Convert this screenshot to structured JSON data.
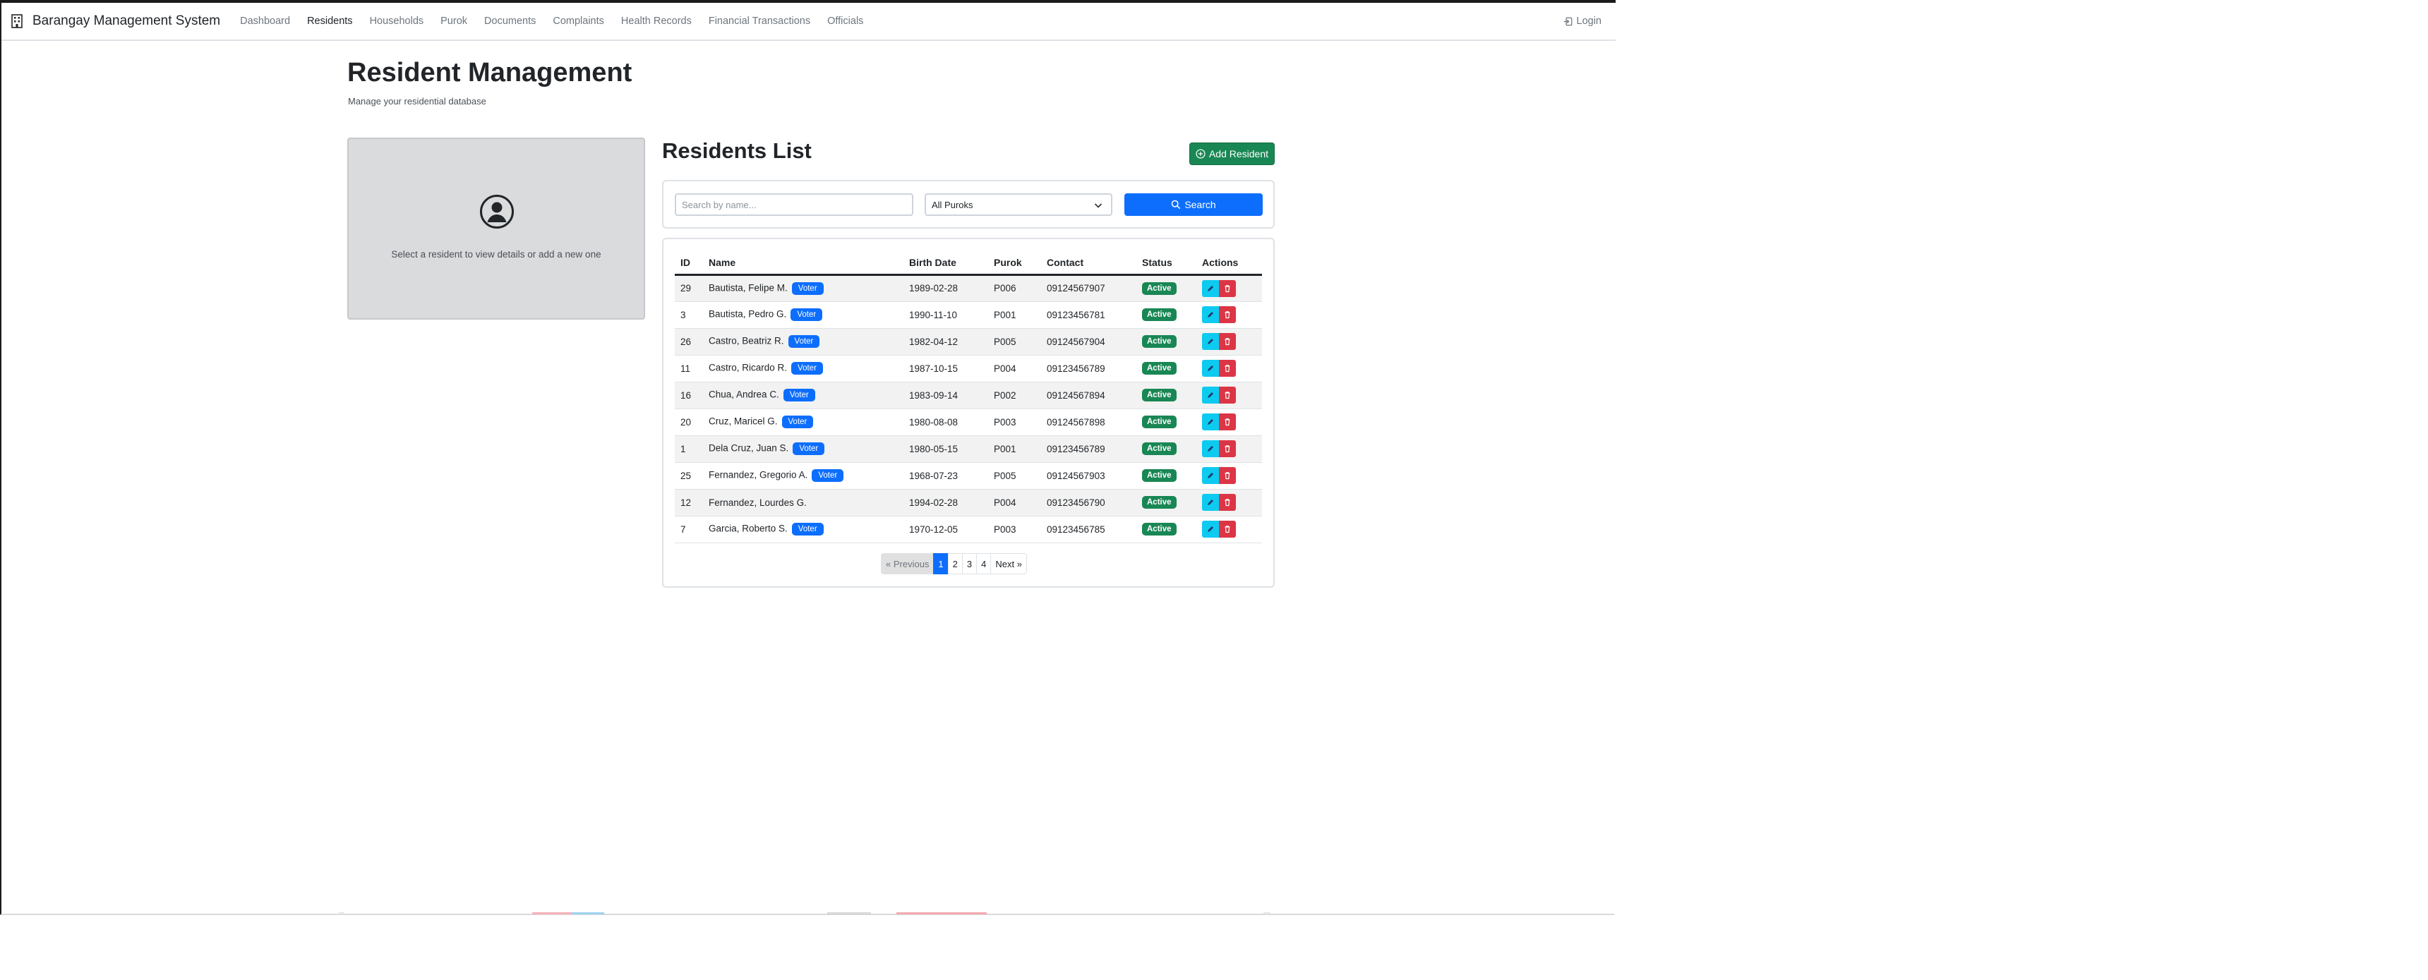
{
  "brand": {
    "title": "Barangay Management System"
  },
  "nav": {
    "items": [
      "Dashboard",
      "Residents",
      "Households",
      "Purok",
      "Documents",
      "Complaints",
      "Health Records",
      "Financial Transactions",
      "Officials"
    ],
    "active": "Residents",
    "login_label": "Login"
  },
  "header": {
    "title": "Resident Management",
    "subtitle": "Manage your residential database"
  },
  "detail_panel": {
    "placeholder_text": "Select a resident to view details or add a new one"
  },
  "residents": {
    "title": "Residents List",
    "add_button_label": "Add Resident",
    "search": {
      "placeholder": "Search by name...",
      "purok_selected": "All Puroks",
      "button_label": "Search"
    },
    "columns": [
      "ID",
      "Name",
      "Birth Date",
      "Purok",
      "Contact",
      "Status",
      "Actions"
    ],
    "rows": [
      {
        "id": "29",
        "name": "Bautista, Felipe M.",
        "voter": "Voter",
        "birth_date": "1989-02-28",
        "purok": "P006",
        "contact": "09124567907",
        "status": "Active"
      },
      {
        "id": "3",
        "name": "Bautista, Pedro G.",
        "voter": "Voter",
        "birth_date": "1990-11-10",
        "purok": "P001",
        "contact": "09123456781",
        "status": "Active"
      },
      {
        "id": "26",
        "name": "Castro, Beatriz R.",
        "voter": "Voter",
        "birth_date": "1982-04-12",
        "purok": "P005",
        "contact": "09124567904",
        "status": "Active"
      },
      {
        "id": "11",
        "name": "Castro, Ricardo R.",
        "voter": "Voter",
        "birth_date": "1987-10-15",
        "purok": "P004",
        "contact": "09123456789",
        "status": "Active"
      },
      {
        "id": "16",
        "name": "Chua, Andrea C.",
        "voter": "Voter",
        "birth_date": "1983-09-14",
        "purok": "P002",
        "contact": "09124567894",
        "status": "Active"
      },
      {
        "id": "20",
        "name": "Cruz, Maricel G.",
        "voter": "Voter",
        "birth_date": "1980-08-08",
        "purok": "P003",
        "contact": "09124567898",
        "status": "Active"
      },
      {
        "id": "1",
        "name": "Dela Cruz, Juan S.",
        "voter": "Voter",
        "birth_date": "1980-05-15",
        "purok": "P001",
        "contact": "09123456789",
        "status": "Active"
      },
      {
        "id": "25",
        "name": "Fernandez, Gregorio A.",
        "voter": "Voter",
        "birth_date": "1968-07-23",
        "purok": "P005",
        "contact": "09124567903",
        "status": "Active"
      },
      {
        "id": "12",
        "name": "Fernandez, Lourdes G.",
        "voter": "",
        "birth_date": "1994-02-28",
        "purok": "P004",
        "contact": "09123456790",
        "status": "Active"
      },
      {
        "id": "7",
        "name": "Garcia, Roberto S.",
        "voter": "Voter",
        "birth_date": "1970-12-05",
        "purok": "P003",
        "contact": "09123456785",
        "status": "Active"
      }
    ],
    "pagination": {
      "previous": "« Previous",
      "pages": [
        "1",
        "2",
        "3",
        "4"
      ],
      "current": "1",
      "next": "Next »"
    }
  },
  "colors": {
    "primary": "#0d6efd",
    "success": "#198754",
    "danger": "#dc3545",
    "info": "#0dcaf0"
  }
}
